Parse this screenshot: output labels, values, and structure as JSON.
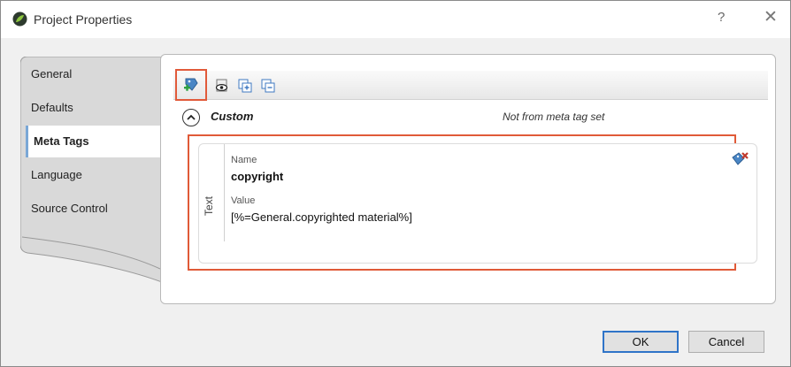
{
  "window": {
    "title": "Project Properties",
    "help_label": "?",
    "close_label": "✕"
  },
  "nav": {
    "items": [
      {
        "label": "General",
        "active": false
      },
      {
        "label": "Defaults",
        "active": false
      },
      {
        "label": "Meta Tags",
        "active": true
      },
      {
        "label": "Language",
        "active": false
      },
      {
        "label": "Source Control",
        "active": false
      }
    ]
  },
  "toolbar": {
    "buttons": [
      {
        "icon": "add-tag-icon",
        "highlighted": true
      },
      {
        "icon": "preview-eye-icon",
        "highlighted": false
      },
      {
        "icon": "expand-all-icon",
        "highlighted": false
      },
      {
        "icon": "collapse-all-icon",
        "highlighted": false
      }
    ]
  },
  "section": {
    "title": "Custom",
    "note": "Not from meta tag set"
  },
  "tag": {
    "type": "Text",
    "name_label": "Name",
    "name_value": "copyright",
    "value_label": "Value",
    "value_value": "[%=General.copyrighted material%]"
  },
  "footer": {
    "ok_label": "OK",
    "cancel_label": "Cancel"
  },
  "colors": {
    "highlight": "#e05a38",
    "accent": "#2f74c8"
  }
}
